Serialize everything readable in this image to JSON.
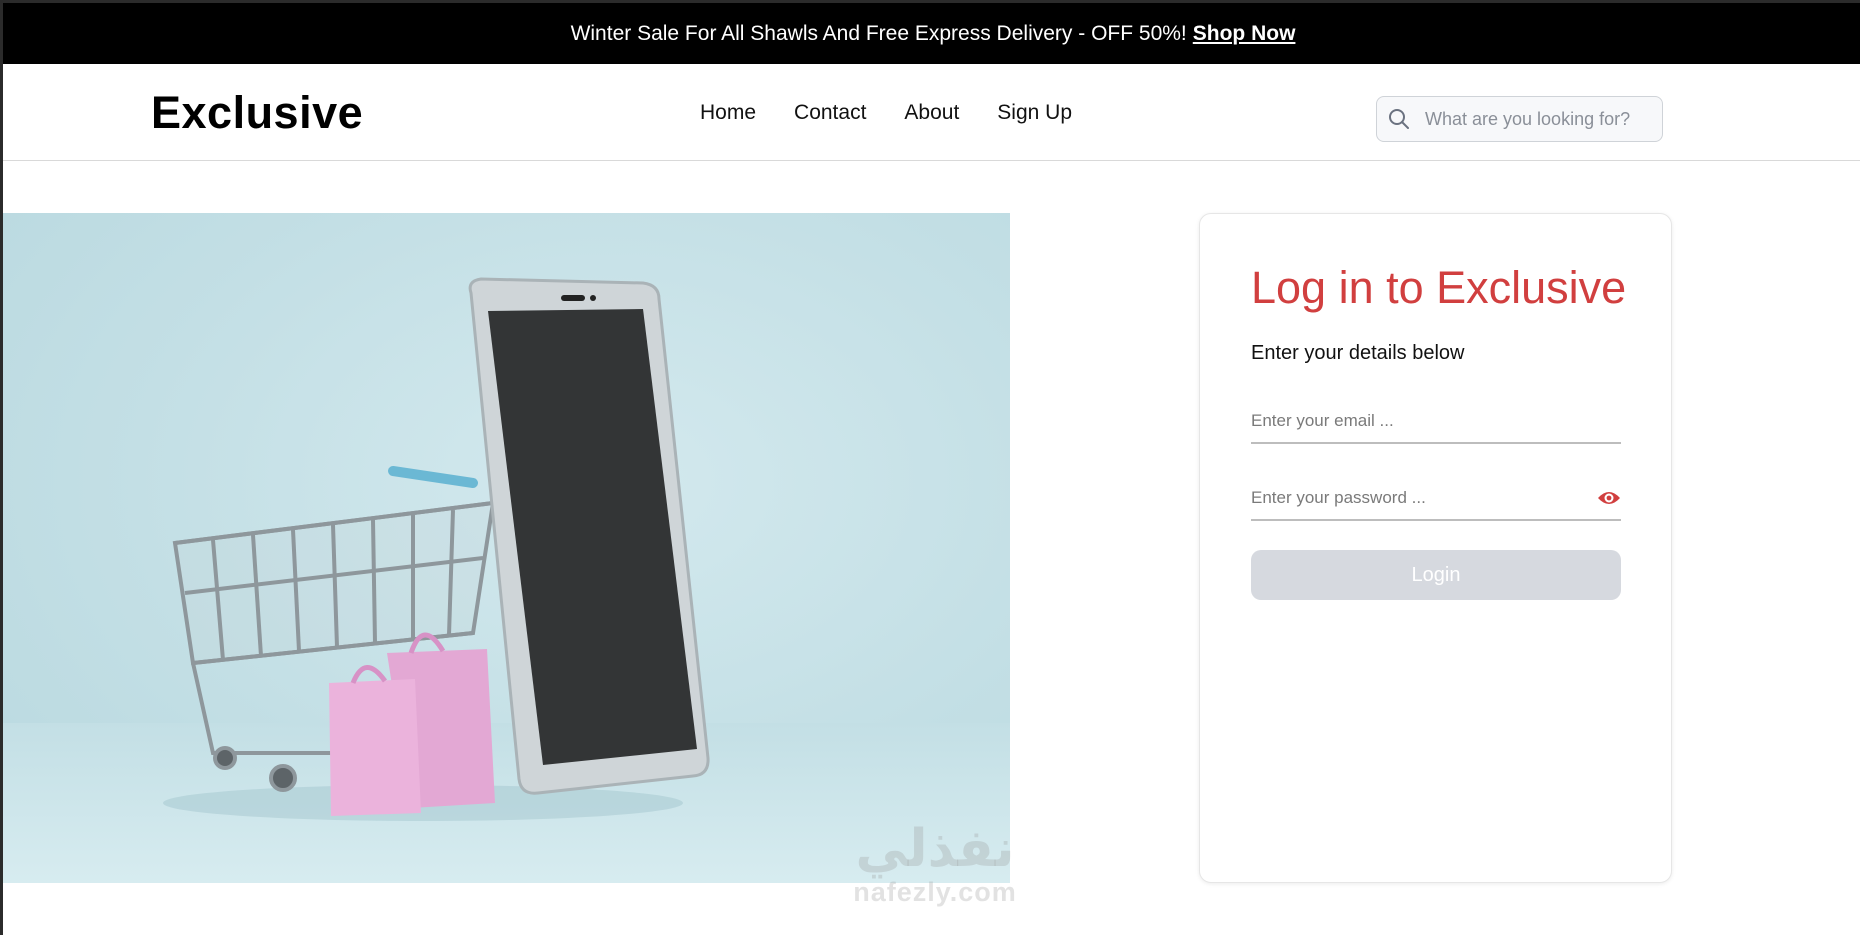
{
  "announcement": {
    "message": "Winter Sale For All Shawls And Free Express Delivery - OFF 50%!",
    "link_label": "Shop Now"
  },
  "header": {
    "logo": "Exclusive",
    "nav": [
      "Home",
      "Contact",
      "About",
      "Sign Up"
    ],
    "search_placeholder": "What are you looking for?"
  },
  "hero": {
    "icon": "shopping-cart-phone-illustration"
  },
  "login": {
    "title": "Log in to Exclusive",
    "subtitle": "Enter your details below",
    "email_placeholder": "Enter your email ...",
    "password_placeholder": "Enter your password ...",
    "button_label": "Login",
    "password_toggle_icon": "eye-icon"
  },
  "watermark": {
    "arabic": "نفذلي",
    "text": "nafezly.com"
  },
  "colors": {
    "accent": "#d13f3f",
    "topbar": "#000000",
    "button_disabled": "#d6d9df",
    "hero_bg": "#c3dfe5"
  }
}
